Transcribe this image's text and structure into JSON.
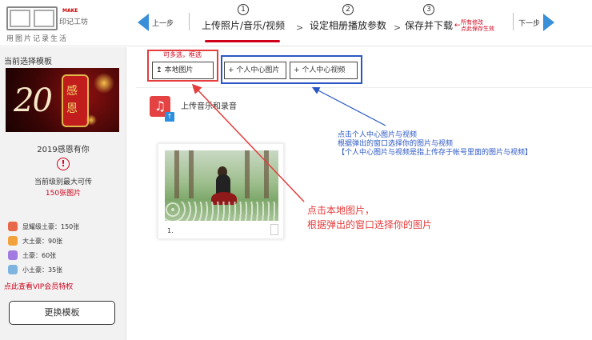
{
  "logo": {
    "make": "MAKE",
    "brand": "印记工坊",
    "slogan": "用图片记录生活"
  },
  "nav": {
    "prev_label": "上一步",
    "next_label": "下一步",
    "steps": [
      {
        "num": "1",
        "label": "上传照片/音乐/视频"
      },
      {
        "num": "2",
        "label": "设定相册播放参数"
      },
      {
        "num": "3",
        "label": "保存并下载"
      }
    ],
    "separator": ">",
    "save_note_line1": "所有修改",
    "save_note_line2": "点此保存生效",
    "save_arrow": "←"
  },
  "sidebar": {
    "title": "当前选择模板",
    "template_year": "20",
    "template_chars": "感恩",
    "template_name": "2019感恩有你",
    "warn_symbol": "!",
    "limit_label": "当前级别最大可传",
    "limit_value": "150张图片",
    "vip_levels": [
      {
        "label": "显耀级土豪：150张",
        "color": "#e8694a"
      },
      {
        "label": "大土豪：90张",
        "color": "#f2a23c"
      },
      {
        "label": "土豪：60张",
        "color": "#a37be0"
      },
      {
        "label": "小土豪：35张",
        "color": "#7fb4e0"
      }
    ],
    "vip_link": "点此查看VIP会员特权",
    "change_button": "更换模板"
  },
  "main": {
    "multi_select_note": "可多选，框选",
    "upload_icon": "↥",
    "local_button": "本地图片",
    "personal_pic_button": "+ 个人中心图片",
    "personal_video_button": "+ 个人中心视频",
    "music_label": "上传音乐和录音",
    "music_icon_glyph": "♫",
    "music_upload_glyph": "↑",
    "photo_number": "1."
  },
  "annotations": {
    "blue_lines": [
      "点击个人中心图片与视频",
      "根据弹出的窗口选择你的图片与视频",
      "【个人中心图片与视频是指上传存于帐号里面的图片与视频】"
    ],
    "red_lines": [
      "点击本地图片，",
      "根据弹出的窗口选择你的图片"
    ]
  },
  "colors": {
    "accent_blue": "#3a8fd9",
    "accent_red": "#d0021b",
    "annot_blue": "#2b57c5",
    "annot_red": "#e53c3c"
  }
}
